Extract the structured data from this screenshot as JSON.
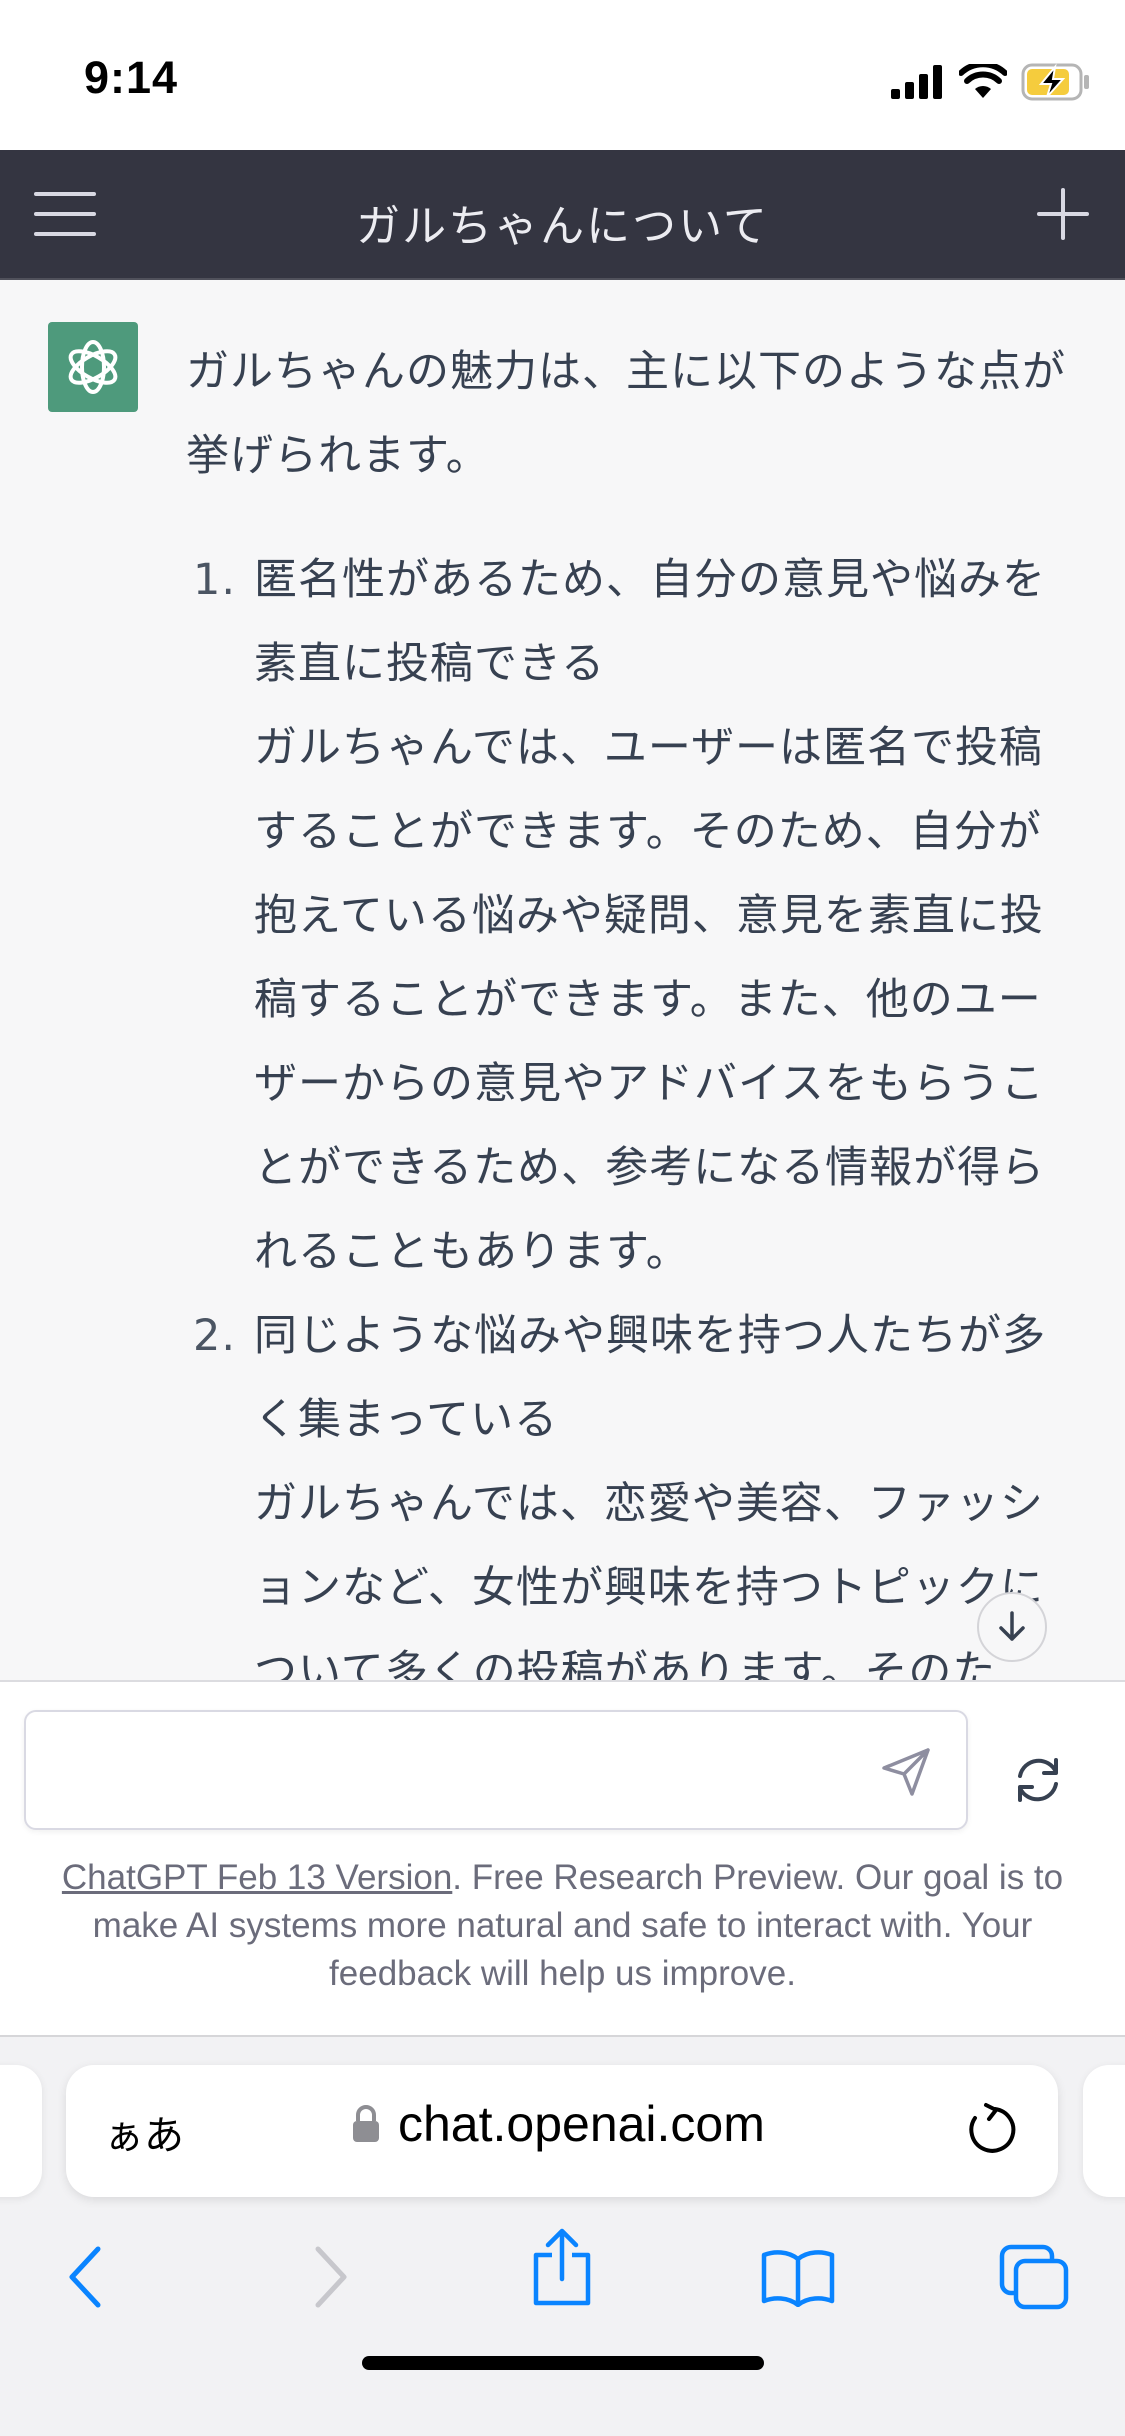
{
  "status_bar": {
    "time": "9:14",
    "icons": [
      "cellular-signal-icon",
      "wifi-icon",
      "battery-charging-icon"
    ]
  },
  "header": {
    "title": "ガルちゃんについて",
    "menu_icon": "hamburger-menu-icon",
    "new_chat_icon": "plus-icon"
  },
  "message": {
    "avatar_icon": "openai-logo-icon",
    "intro": "ガルちゃんの魅力は、主に以下のような点が挙げられます。",
    "items": [
      {
        "number": "1.",
        "title": "匿名性があるため、自分の意見や悩みを素直に投稿できる",
        "body": "ガルちゃんでは、ユーザーは匿名で投稿することができます。そのため、自分が抱えている悩みや疑問、意見を素直に投稿することができます。また、他のユーザーからの意見やアドバイスをもらうことができるため、参考になる情報が得られることもあります。"
      },
      {
        "number": "2.",
        "title": "同じような悩みや興味を持つ人たちが多く集まっている",
        "body": "ガルちゃんでは、恋愛や美容、ファッションなど、女性が興味を持つトピックについて多くの投稿があります。そのた"
      }
    ]
  },
  "composer": {
    "input_value": "",
    "send_icon": "send-icon",
    "regenerate_icon": "refresh-icon",
    "disclaimer_link": "ChatGPT Feb 13 Version",
    "disclaimer_text": ". Free Research Preview. Our goal is to make AI systems more natural and safe to interact with. Your feedback will help us improve."
  },
  "browser": {
    "aa_label": "ぁあ",
    "url": "chat.openai.com",
    "toolbar_icons": [
      "back-icon",
      "forward-icon",
      "share-icon",
      "bookmarks-icon",
      "tabs-icon"
    ]
  },
  "colors": {
    "header_bg": "#343541",
    "avatar_bg": "#4e9a7c",
    "chat_bg": "#f7f7f8",
    "ios_blue": "#0a84ff"
  }
}
